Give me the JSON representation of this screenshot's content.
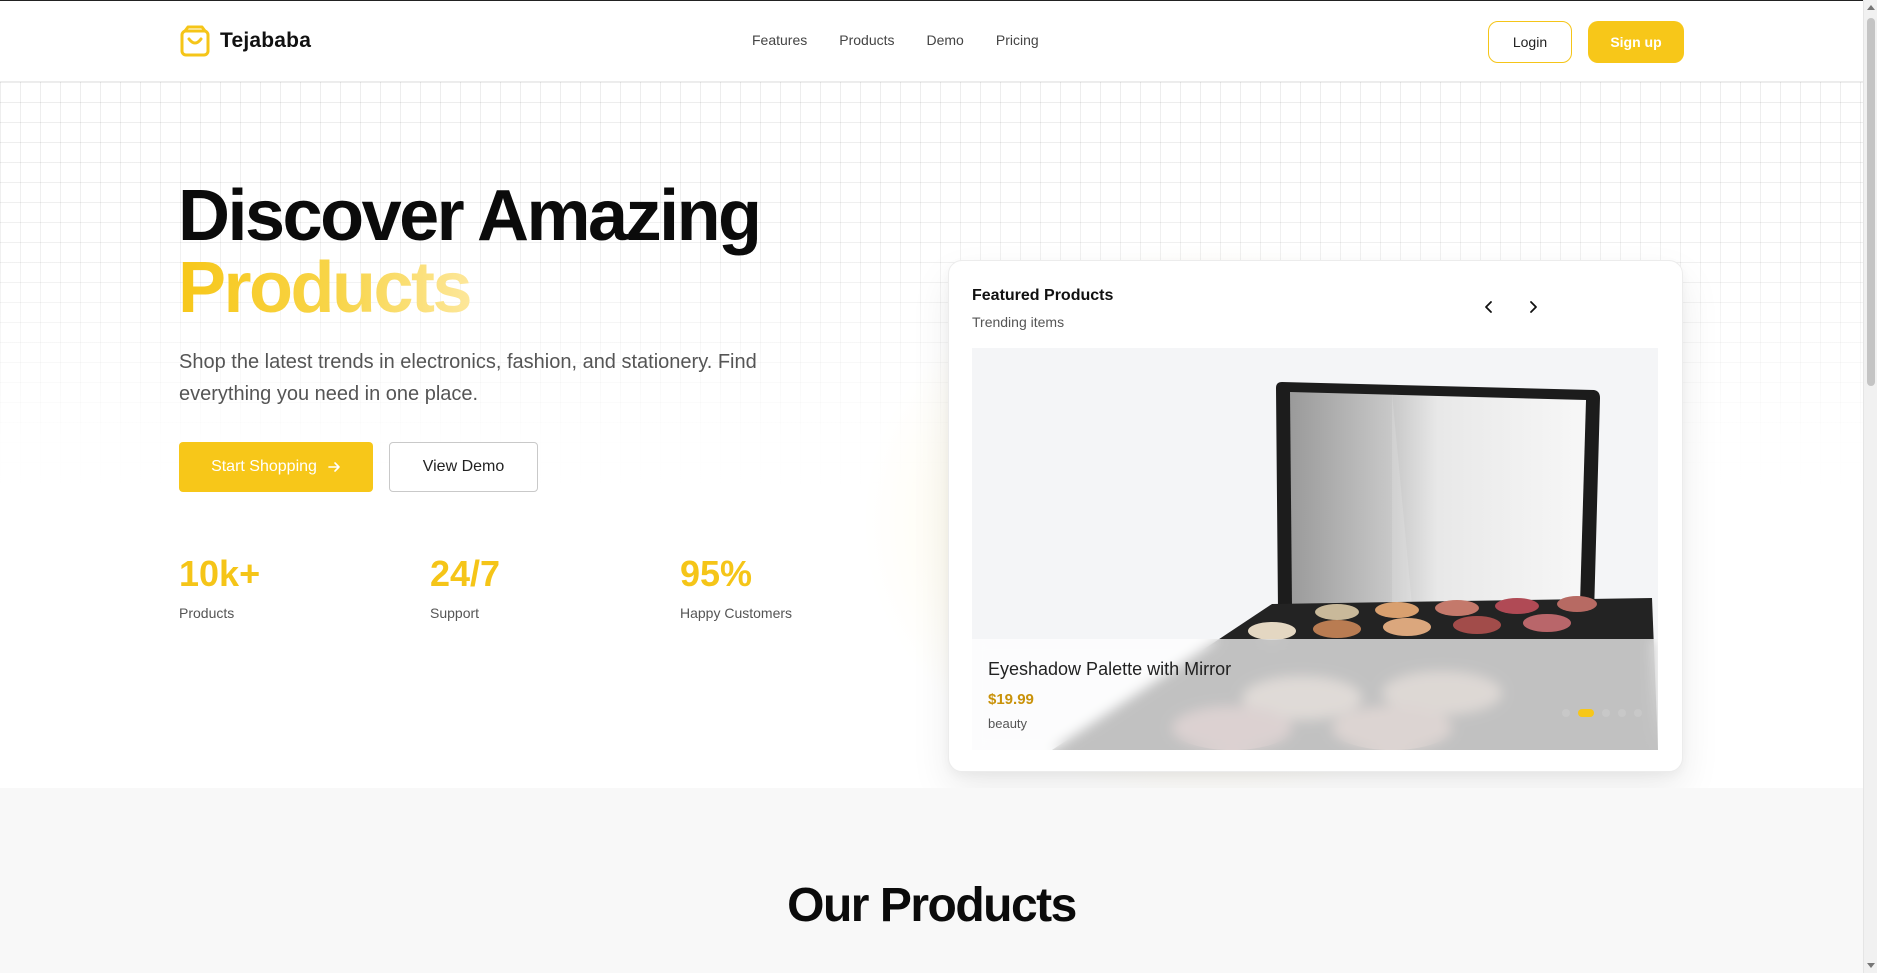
{
  "brand": {
    "name": "Tejababa",
    "icon": "shopping-bag-icon",
    "accent_color": "#f7c719"
  },
  "nav": {
    "links": [
      "Features",
      "Products",
      "Demo",
      "Pricing"
    ],
    "login_label": "Login",
    "signup_label": "Sign up"
  },
  "hero": {
    "title_line1": "Discover Amazing",
    "title_line2": "Products",
    "subtitle": "Shop the latest trends in electronics, fashion, and stationery. Find everything you need in one place.",
    "primary_button": "Start Shopping",
    "primary_icon": "arrow-right-icon",
    "secondary_button": "View Demo",
    "stats": [
      {
        "value": "10k+",
        "label": "Products"
      },
      {
        "value": "24/7",
        "label": "Support"
      },
      {
        "value": "95%",
        "label": "Happy Customers"
      }
    ]
  },
  "featured": {
    "title": "Featured Products",
    "subtitle": "Trending items",
    "prev_icon": "chevron-left-icon",
    "next_icon": "chevron-right-icon",
    "product": {
      "name": "Eyeshadow Palette with Mirror",
      "price": "$19.99",
      "category": "beauty"
    },
    "carousel": {
      "slide_count": 5,
      "active_index": 1
    }
  },
  "products_section": {
    "title": "Our Products"
  }
}
